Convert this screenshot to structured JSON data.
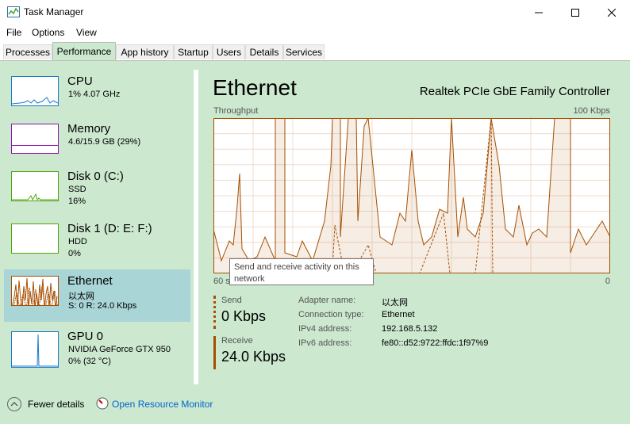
{
  "window": {
    "title": "Task Manager"
  },
  "menu": [
    "File",
    "Options",
    "View"
  ],
  "tabs": [
    {
      "label": "Processes",
      "active": false
    },
    {
      "label": "Performance",
      "active": true
    },
    {
      "label": "App history",
      "active": false
    },
    {
      "label": "Startup",
      "active": false
    },
    {
      "label": "Users",
      "active": false
    },
    {
      "label": "Details",
      "active": false
    },
    {
      "label": "Services",
      "active": false
    }
  ],
  "sidebar": {
    "items": [
      {
        "name": "CPU",
        "line1": "1% 4.07 GHz",
        "line2": "",
        "color": "#1a7ac6"
      },
      {
        "name": "Memory",
        "line1": "4.6/15.9 GB (29%)",
        "line2": "",
        "color": "#8b12ae"
      },
      {
        "name": "Disk 0 (C:)",
        "line1": "SSD",
        "line2": "16%",
        "color": "#4da60c"
      },
      {
        "name": "Disk 1 (D: E: F:)",
        "line1": "HDD",
        "line2": "0%",
        "color": "#4da60c"
      },
      {
        "name": "Ethernet",
        "line1": "以太网",
        "line2": "S: 0 R: 24.0 Kbps",
        "color": "#a74f01",
        "selected": true
      },
      {
        "name": "GPU 0",
        "line1": "NVIDIA GeForce GTX 950",
        "line2": "0% (32 °C)",
        "color": "#1a7ac6"
      }
    ]
  },
  "main": {
    "title": "Ethernet",
    "adapter": "Realtek PCIe GbE Family Controller",
    "graph_label": "Throughput",
    "graph_max": "100 Kbps",
    "graph_time": "60 s",
    "graph_min": "0",
    "tooltip": "Send and receive activity on this network",
    "send": {
      "label": "Send",
      "value": "0 Kbps"
    },
    "receive": {
      "label": "Receive",
      "value": "24.0 Kbps"
    },
    "details": [
      {
        "key": "Adapter name:",
        "value": "以太网"
      },
      {
        "key": "Connection type:",
        "value": "Ethernet"
      },
      {
        "key": "IPv4 address:",
        "value": "192.168.5.132"
      },
      {
        "key": "IPv6 address:",
        "value": "fe80::d52:9722:ffdc:1f97%9"
      }
    ]
  },
  "footer": {
    "fewer_details": "Fewer details",
    "open_rm": "Open Resource Monitor"
  },
  "colors": {
    "ethernet": "#a74f01",
    "background": "#cce8cf",
    "selected": "#a9d5d6"
  }
}
